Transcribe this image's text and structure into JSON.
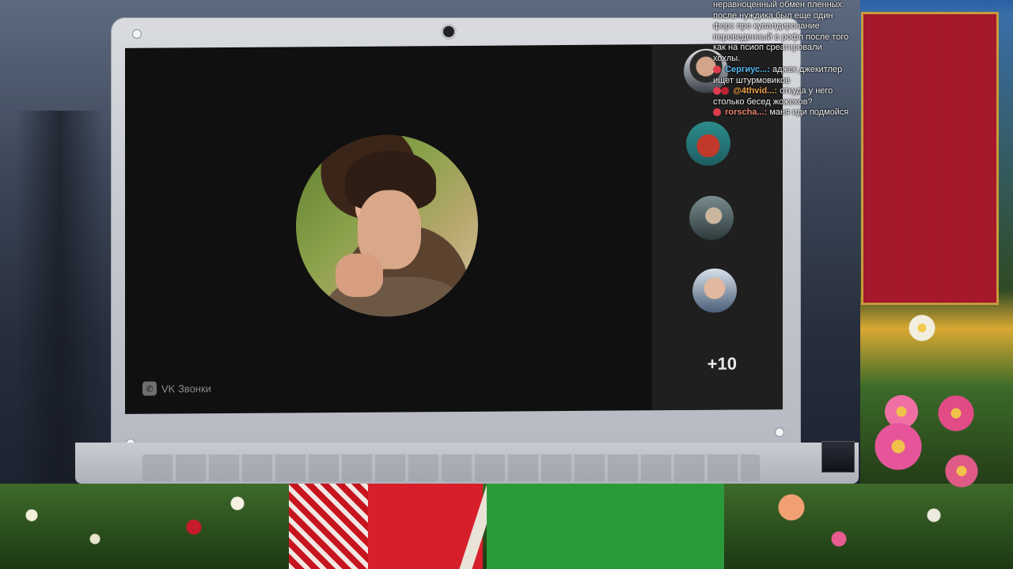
{
  "video_call": {
    "brand_label": "VK Звонки",
    "brand_icon": "phone-icon",
    "extra_participants": "+10"
  },
  "chat": {
    "intro_lines": [
      "неравноценный обмен пленных.",
      "после нуждика был еще один",
      "форс про кувалдирование",
      "переведенный в рофл после того",
      "как на псиоп среагировали",
      "хохлы."
    ],
    "messages": [
      {
        "user": "Сергиус...:",
        "text": "аджек джекитлер ищет штурмовиков"
      },
      {
        "user": "@4thvid...:",
        "text": "откуда у него столько бесед жожеков?"
      },
      {
        "user": "rorscha...:",
        "text": "маня иди подмойся"
      }
    ]
  },
  "colors": {
    "chat_user_1": "#5bbcf5",
    "chat_user_2": "#f2a64d",
    "chat_user_3": "#e8826c",
    "call_background": "#101010"
  }
}
